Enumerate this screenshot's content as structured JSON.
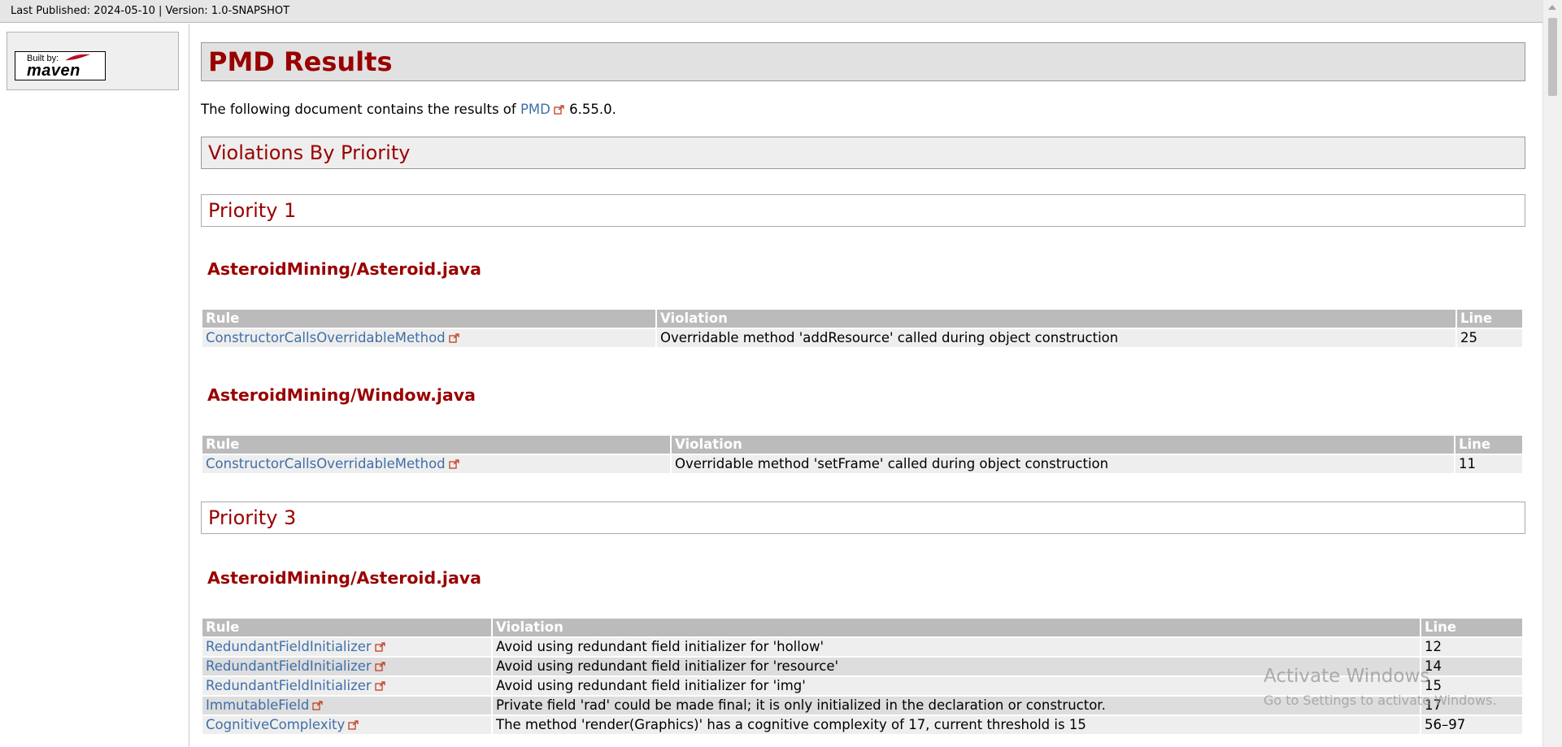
{
  "top_bar": {
    "text": "Last Published: 2024-05-10 | Version: 1.0-SNAPSHOT"
  },
  "sidebar": {
    "badge_built": "Built by:",
    "badge_name": "maven"
  },
  "page": {
    "title": "PMD Results",
    "intro_prefix": "The following document contains the results of",
    "intro_link": "PMD",
    "intro_suffix": "6.55.0."
  },
  "sections": {
    "violations_by_priority": "Violations By Priority",
    "priority1": "Priority 1",
    "priority3": "Priority 3"
  },
  "table_headers": {
    "rule": "Rule",
    "violation": "Violation",
    "line": "Line"
  },
  "p1": {
    "file1": {
      "name": "AsteroidMining/Asteroid.java",
      "rows": [
        {
          "rule": "ConstructorCallsOverridableMethod",
          "violation": "Overridable method 'addResource' called during object construction",
          "line": "25"
        }
      ]
    },
    "file2": {
      "name": "AsteroidMining/Window.java",
      "rows": [
        {
          "rule": "ConstructorCallsOverridableMethod",
          "violation": "Overridable method 'setFrame' called during object construction",
          "line": "11"
        }
      ]
    }
  },
  "p3": {
    "file1": {
      "name": "AsteroidMining/Asteroid.java",
      "rows": [
        {
          "rule": "RedundantFieldInitializer",
          "violation": "Avoid using redundant field initializer for 'hollow'",
          "line": "12"
        },
        {
          "rule": "RedundantFieldInitializer",
          "violation": "Avoid using redundant field initializer for 'resource'",
          "line": "14"
        },
        {
          "rule": "RedundantFieldInitializer",
          "violation": "Avoid using redundant field initializer for 'img'",
          "line": "15"
        },
        {
          "rule": "ImmutableField",
          "violation": "Private field 'rad' could be made final; it is only initialized in the declaration or constructor.",
          "line": "17"
        },
        {
          "rule": "CognitiveComplexity",
          "violation": "The method 'render(Graphics)' has a cognitive complexity of 17, current threshold is 15",
          "line": "56–97"
        }
      ]
    }
  },
  "watermark": {
    "title": "Activate Windows",
    "subtitle": "Go to Settings to activate Windows."
  },
  "colors": {
    "heading": "#990000",
    "link": "#3f6fa8",
    "table_header": "#bbbbbb"
  },
  "icons": {
    "external_link": "external-link-icon"
  }
}
